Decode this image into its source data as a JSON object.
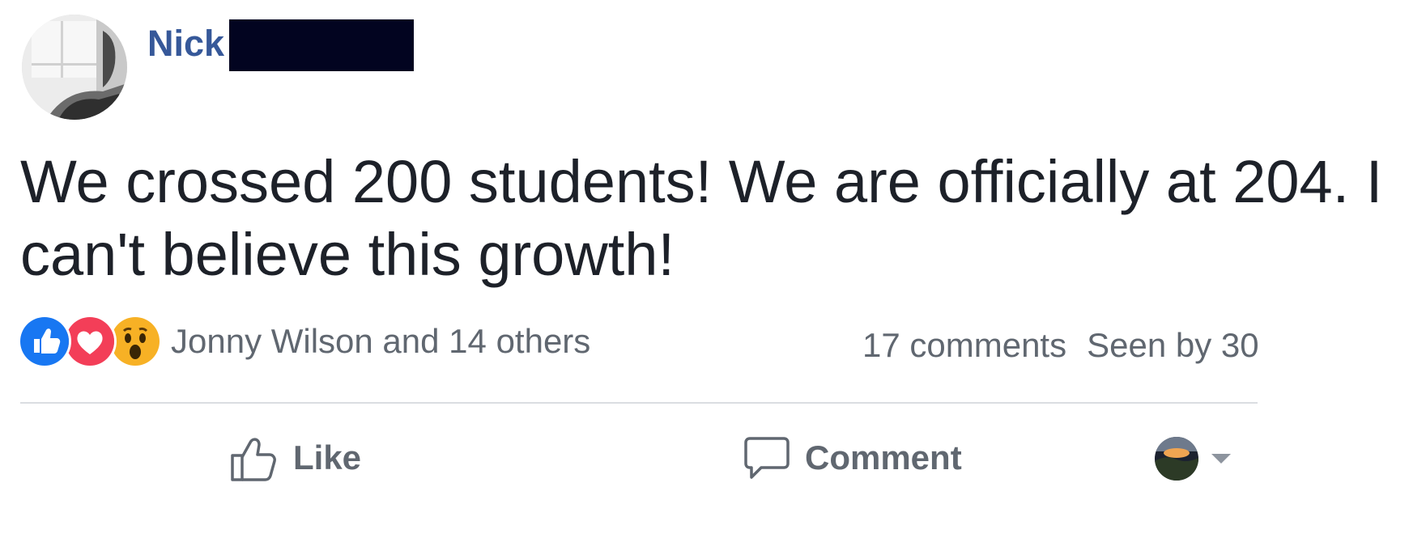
{
  "post": {
    "author_first_name": "Nick",
    "text": "We crossed 200 students! We are officially at 204. I can't believe this growth!",
    "reactions": {
      "icons": [
        "like-icon",
        "love-icon",
        "wow-icon"
      ],
      "summary": "Jonny Wilson and 14 others"
    },
    "stats": {
      "comments": "17 comments",
      "seen": "Seen by 30"
    },
    "actions": {
      "like_label": "Like",
      "comment_label": "Comment"
    }
  },
  "colors": {
    "author_link": "#365899",
    "secondary_text": "#606770",
    "like_blue": "#1877f2",
    "love_red": "#f33e58",
    "wow_yellow": "#f7b125",
    "redaction": "#020420"
  }
}
